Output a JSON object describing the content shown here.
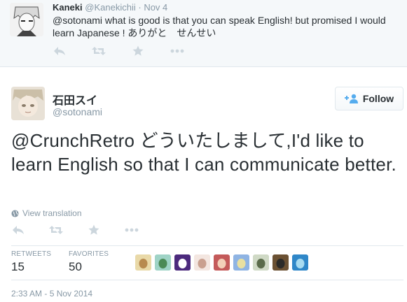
{
  "reply": {
    "name": "Kaneki",
    "handle": "@Kanekichii",
    "separator": "·",
    "date": "Nov 4",
    "text": "@sotonami what is good is that you can speak English! but promised I would learn Japanese ! ありがと　せんせい"
  },
  "tweet": {
    "name": "石田スイ",
    "handle": "@sotonami",
    "follow_label": "Follow",
    "text": "@CrunchRetro どういたしまして,I'd like to learn English so that I can communicate better.",
    "view_translation": "View translation",
    "retweets_label": "RETWEETS",
    "retweets_count": "15",
    "favorites_label": "FAVORITES",
    "favorites_count": "50",
    "timestamp": "2:33 AM - 5 Nov 2014"
  },
  "icons": {
    "reply": "reply-icon",
    "retweet": "retweet-icon",
    "favorite": "star-icon",
    "more": "more-icon",
    "follow": "add-user-icon",
    "globe": "globe-icon"
  },
  "colors": {
    "action_icon": "#ccd6dd",
    "follow_icon": "#55acee",
    "muted_text": "#8899a6",
    "reply_background": "#f5f8fa"
  },
  "favoriter_avatars": [
    {
      "bg": "#e9d9a8",
      "fg": "#b88a4f"
    },
    {
      "bg": "#9fd3c6",
      "fg": "#4b8a55"
    },
    {
      "bg": "#4c2a7d",
      "fg": "#ffffff"
    },
    {
      "bg": "#f3e6e0",
      "fg": "#c9a08f"
    },
    {
      "bg": "#c45a5a",
      "fg": "#f3d0b9"
    },
    {
      "bg": "#8fb4e3",
      "fg": "#e9e0a0"
    },
    {
      "bg": "#cfd9c5",
      "fg": "#5a6b4a"
    },
    {
      "bg": "#6b5133",
      "fg": "#2b2a28"
    },
    {
      "bg": "#2f87c8",
      "fg": "#a8dbf0"
    }
  ]
}
